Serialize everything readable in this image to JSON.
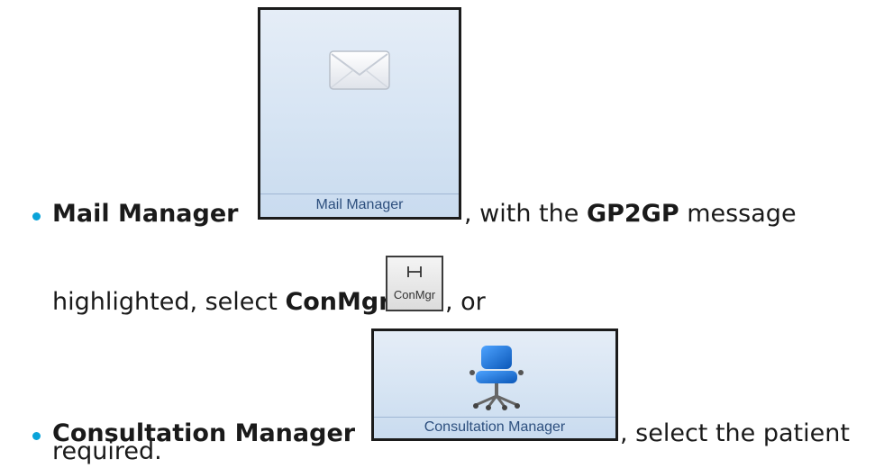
{
  "items": [
    {
      "label": "Mail Manager",
      "button_caption": "Mail Manager",
      "text_after": ", with the ",
      "message_name": "GP2GP",
      "text_after_2": " message",
      "line2_prefix": "highlighted, select ",
      "conmgr_label": "ConMgr",
      "conmgr_caption": "ConMgr",
      "line2_suffix": ", or"
    },
    {
      "label": "Consultation Manager",
      "button_caption": "Consultation Manager",
      "text_after": ", select the patient",
      "line2": "required."
    }
  ],
  "colors": {
    "bullet": "#0aa3d9",
    "caption": "#2d4f7e",
    "chair": "#1f6fd0"
  },
  "icons": [
    "envelope-icon",
    "pin-icon",
    "chair-icon"
  ]
}
